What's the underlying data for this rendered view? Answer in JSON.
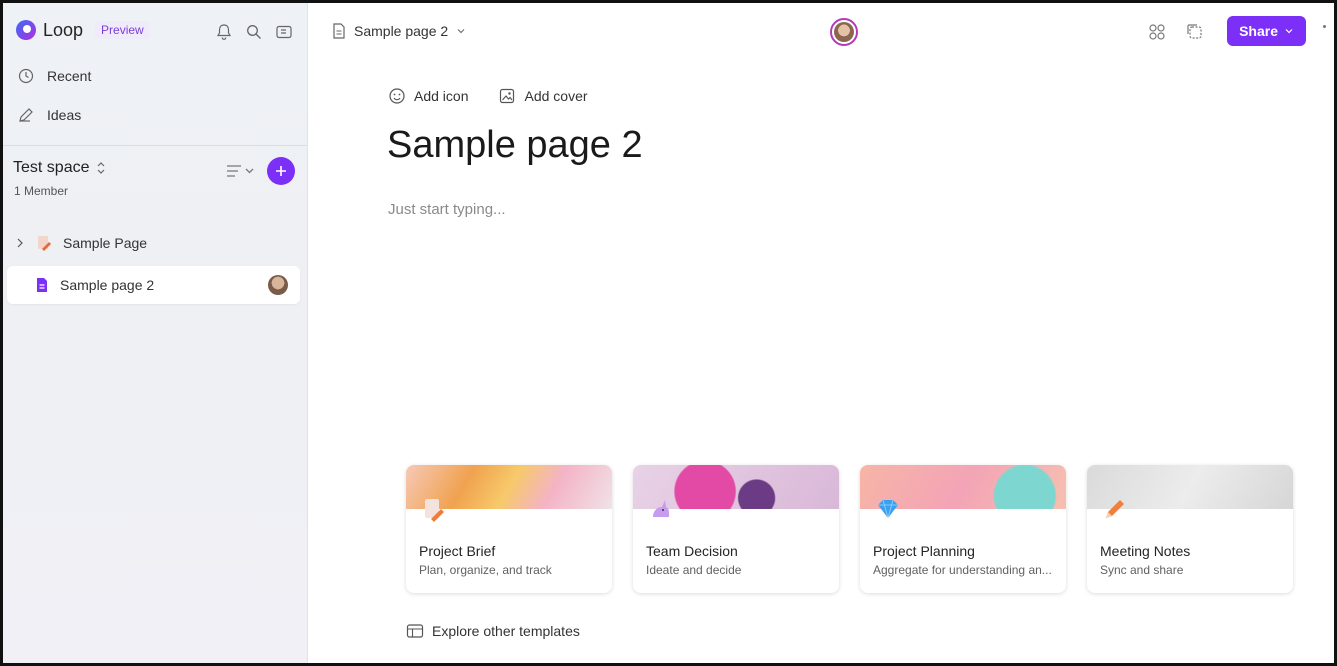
{
  "app": {
    "name": "Loop",
    "badge": "Preview"
  },
  "sidebar": {
    "nav": [
      {
        "label": "Recent",
        "icon": "clock-icon"
      },
      {
        "label": "Ideas",
        "icon": "pencil-icon"
      }
    ],
    "space": {
      "title": "Test space",
      "members": "1 Member"
    },
    "pages": [
      {
        "label": "Sample Page",
        "icon": "page-pencil-icon",
        "active": false
      },
      {
        "label": "Sample page 2",
        "icon": "page-icon",
        "active": true
      }
    ]
  },
  "header": {
    "breadcrumb": "Sample page 2",
    "share_label": "Share"
  },
  "page": {
    "add_icon_label": "Add icon",
    "add_cover_label": "Add cover",
    "title": "Sample page 2",
    "placeholder": "Just start typing..."
  },
  "templates": [
    {
      "title": "Project Brief",
      "desc": "Plan, organize, and track",
      "icon": "document-pencil-icon"
    },
    {
      "title": "Team Decision",
      "desc": "Ideate and decide",
      "icon": "unicorn-icon"
    },
    {
      "title": "Project Planning",
      "desc": "Aggregate for understanding an...",
      "icon": "gem-icon"
    },
    {
      "title": "Meeting Notes",
      "desc": "Sync and share",
      "icon": "pencil-icon"
    }
  ],
  "explore_label": "Explore other templates",
  "colors": {
    "accent": "#7b2ff7",
    "sidebar_bg": "#eef1f5"
  }
}
